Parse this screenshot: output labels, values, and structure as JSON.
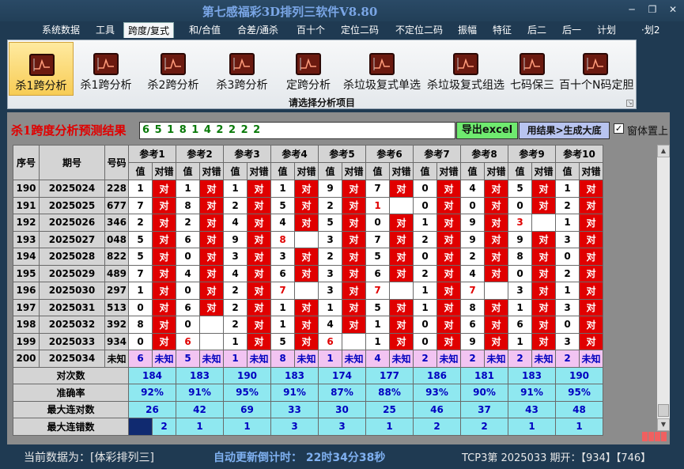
{
  "app": {
    "title": "第七感福彩3D排列三软件V8.80",
    "window_controls": [
      "minimize-icon",
      "restore-icon",
      "close-icon"
    ]
  },
  "menu": [
    "系统数据",
    "工具",
    "跨度/复式",
    "和/合值",
    "合差/通杀",
    "百十个",
    "定位二码",
    "不定位二码",
    "振幅",
    "特征",
    "后二",
    "后一",
    "计划",
    "·划2"
  ],
  "active_menu": "跨度/复式",
  "ribbon": {
    "buttons": [
      "杀1跨分析",
      "杀1跨分析",
      "杀2跨分析",
      "杀3跨分析",
      "定跨分析",
      "杀垃圾复式单选",
      "杀垃圾复式组选",
      "七码保三",
      "百十个N码定胆"
    ],
    "selected_index": 0,
    "group_label": "请选择分析项目"
  },
  "result": {
    "title": "杀1跨度分析预测结果",
    "value": "6 5 1 8 1 4 2 2 2 2",
    "excel_button": "导出excel",
    "generate_button": "用结果>生成大底",
    "always_on_top_label": "窗体置上",
    "always_on_top_checked": true
  },
  "table": {
    "headers": {
      "seq": "序号",
      "period": "期号",
      "number": "号码",
      "refs": [
        "参考1",
        "参考2",
        "参考3",
        "参考4",
        "参考5",
        "参考6",
        "参考7",
        "参考8",
        "参考9",
        "参考10"
      ],
      "value": "值",
      "check": "对错"
    },
    "hit_text": "对",
    "rows": [
      {
        "seq": "190",
        "period": "2025024",
        "num": "228",
        "vals": [
          "1",
          "1",
          "1",
          "1",
          "9",
          "7",
          "0",
          "4",
          "5",
          "1"
        ],
        "hits": [
          1,
          1,
          1,
          1,
          1,
          1,
          1,
          1,
          1,
          1
        ],
        "red": [
          0,
          0,
          0,
          0,
          0,
          0,
          0,
          0,
          0,
          0
        ]
      },
      {
        "seq": "191",
        "period": "2025025",
        "num": "677",
        "vals": [
          "7",
          "8",
          "2",
          "5",
          "2",
          "1",
          "0",
          "0",
          "0",
          "2"
        ],
        "hits": [
          1,
          1,
          1,
          1,
          1,
          0,
          1,
          1,
          1,
          1
        ],
        "red": [
          0,
          0,
          0,
          0,
          0,
          1,
          0,
          0,
          0,
          0
        ]
      },
      {
        "seq": "192",
        "period": "2025026",
        "num": "346",
        "vals": [
          "2",
          "2",
          "4",
          "4",
          "5",
          "0",
          "1",
          "9",
          "3",
          "1"
        ],
        "hits": [
          1,
          1,
          1,
          1,
          1,
          1,
          1,
          1,
          0,
          1
        ],
        "red": [
          0,
          0,
          0,
          0,
          0,
          0,
          0,
          0,
          1,
          0
        ]
      },
      {
        "seq": "193",
        "period": "2025027",
        "num": "048",
        "vals": [
          "5",
          "6",
          "9",
          "8",
          "3",
          "7",
          "2",
          "9",
          "9",
          "3"
        ],
        "hits": [
          1,
          1,
          1,
          0,
          1,
          1,
          1,
          1,
          1,
          1
        ],
        "red": [
          0,
          0,
          0,
          1,
          0,
          0,
          0,
          0,
          0,
          0
        ]
      },
      {
        "seq": "194",
        "period": "2025028",
        "num": "822",
        "vals": [
          "5",
          "0",
          "3",
          "3",
          "2",
          "5",
          "0",
          "2",
          "8",
          "0"
        ],
        "hits": [
          1,
          1,
          1,
          1,
          1,
          1,
          1,
          1,
          1,
          1
        ],
        "red": [
          0,
          0,
          0,
          0,
          0,
          0,
          0,
          0,
          0,
          0
        ]
      },
      {
        "seq": "195",
        "period": "2025029",
        "num": "489",
        "vals": [
          "7",
          "4",
          "4",
          "6",
          "3",
          "6",
          "2",
          "4",
          "0",
          "2"
        ],
        "hits": [
          1,
          1,
          1,
          1,
          1,
          1,
          1,
          1,
          1,
          1
        ],
        "red": [
          0,
          0,
          0,
          0,
          0,
          0,
          0,
          0,
          0,
          0
        ]
      },
      {
        "seq": "196",
        "period": "2025030",
        "num": "297",
        "vals": [
          "1",
          "0",
          "2",
          "7",
          "3",
          "7",
          "1",
          "7",
          "3",
          "1"
        ],
        "hits": [
          1,
          1,
          1,
          0,
          1,
          0,
          1,
          0,
          1,
          1
        ],
        "red": [
          0,
          0,
          0,
          1,
          0,
          1,
          0,
          1,
          0,
          0
        ]
      },
      {
        "seq": "197",
        "period": "2025031",
        "num": "513",
        "vals": [
          "0",
          "6",
          "2",
          "1",
          "1",
          "5",
          "1",
          "8",
          "1",
          "3"
        ],
        "hits": [
          1,
          1,
          1,
          1,
          1,
          1,
          1,
          1,
          1,
          1
        ],
        "red": [
          0,
          0,
          0,
          0,
          0,
          0,
          0,
          0,
          0,
          0
        ]
      },
      {
        "seq": "198",
        "period": "2025032",
        "num": "392",
        "vals": [
          "8",
          "0",
          "2",
          "1",
          "4",
          "1",
          "0",
          "6",
          "6",
          "0"
        ],
        "hits": [
          1,
          0,
          1,
          1,
          1,
          1,
          1,
          1,
          1,
          1
        ],
        "red": [
          0,
          0,
          0,
          0,
          0,
          0,
          0,
          0,
          0,
          0
        ]
      },
      {
        "seq": "199",
        "period": "2025033",
        "num": "934",
        "vals": [
          "0",
          "6",
          "1",
          "5",
          "6",
          "1",
          "0",
          "9",
          "1",
          "3"
        ],
        "hits": [
          1,
          0,
          1,
          1,
          0,
          1,
          1,
          1,
          1,
          1
        ],
        "red": [
          0,
          1,
          0,
          0,
          1,
          0,
          0,
          0,
          0,
          0
        ]
      }
    ],
    "future": {
      "seq": "200",
      "period": "2025034",
      "num": "未知",
      "vals": [
        "6",
        "5",
        "1",
        "8",
        "1",
        "4",
        "2",
        "2",
        "2",
        "2"
      ],
      "check": "未知"
    },
    "stats": [
      {
        "label": "对次数",
        "vals": [
          "184",
          "183",
          "190",
          "183",
          "174",
          "177",
          "186",
          "181",
          "183",
          "190"
        ]
      },
      {
        "label": "准确率",
        "vals": [
          "92%",
          "91%",
          "95%",
          "91%",
          "87%",
          "88%",
          "93%",
          "90%",
          "91%",
          "95%"
        ]
      },
      {
        "label": "最大连对数",
        "vals": [
          "26",
          "42",
          "69",
          "33",
          "30",
          "25",
          "46",
          "37",
          "43",
          "48"
        ]
      },
      {
        "label": "最大连错数",
        "vals": [
          "2",
          "1",
          "1",
          "3",
          "3",
          "1",
          "2",
          "2",
          "1",
          "1"
        ]
      }
    ]
  },
  "status": {
    "source": "当前数据为：[体彩排列三]",
    "countdown": "自动更新倒计时： 22时34分38秒",
    "draw": "TCP3第 2025033 期开：【934】【746】"
  }
}
